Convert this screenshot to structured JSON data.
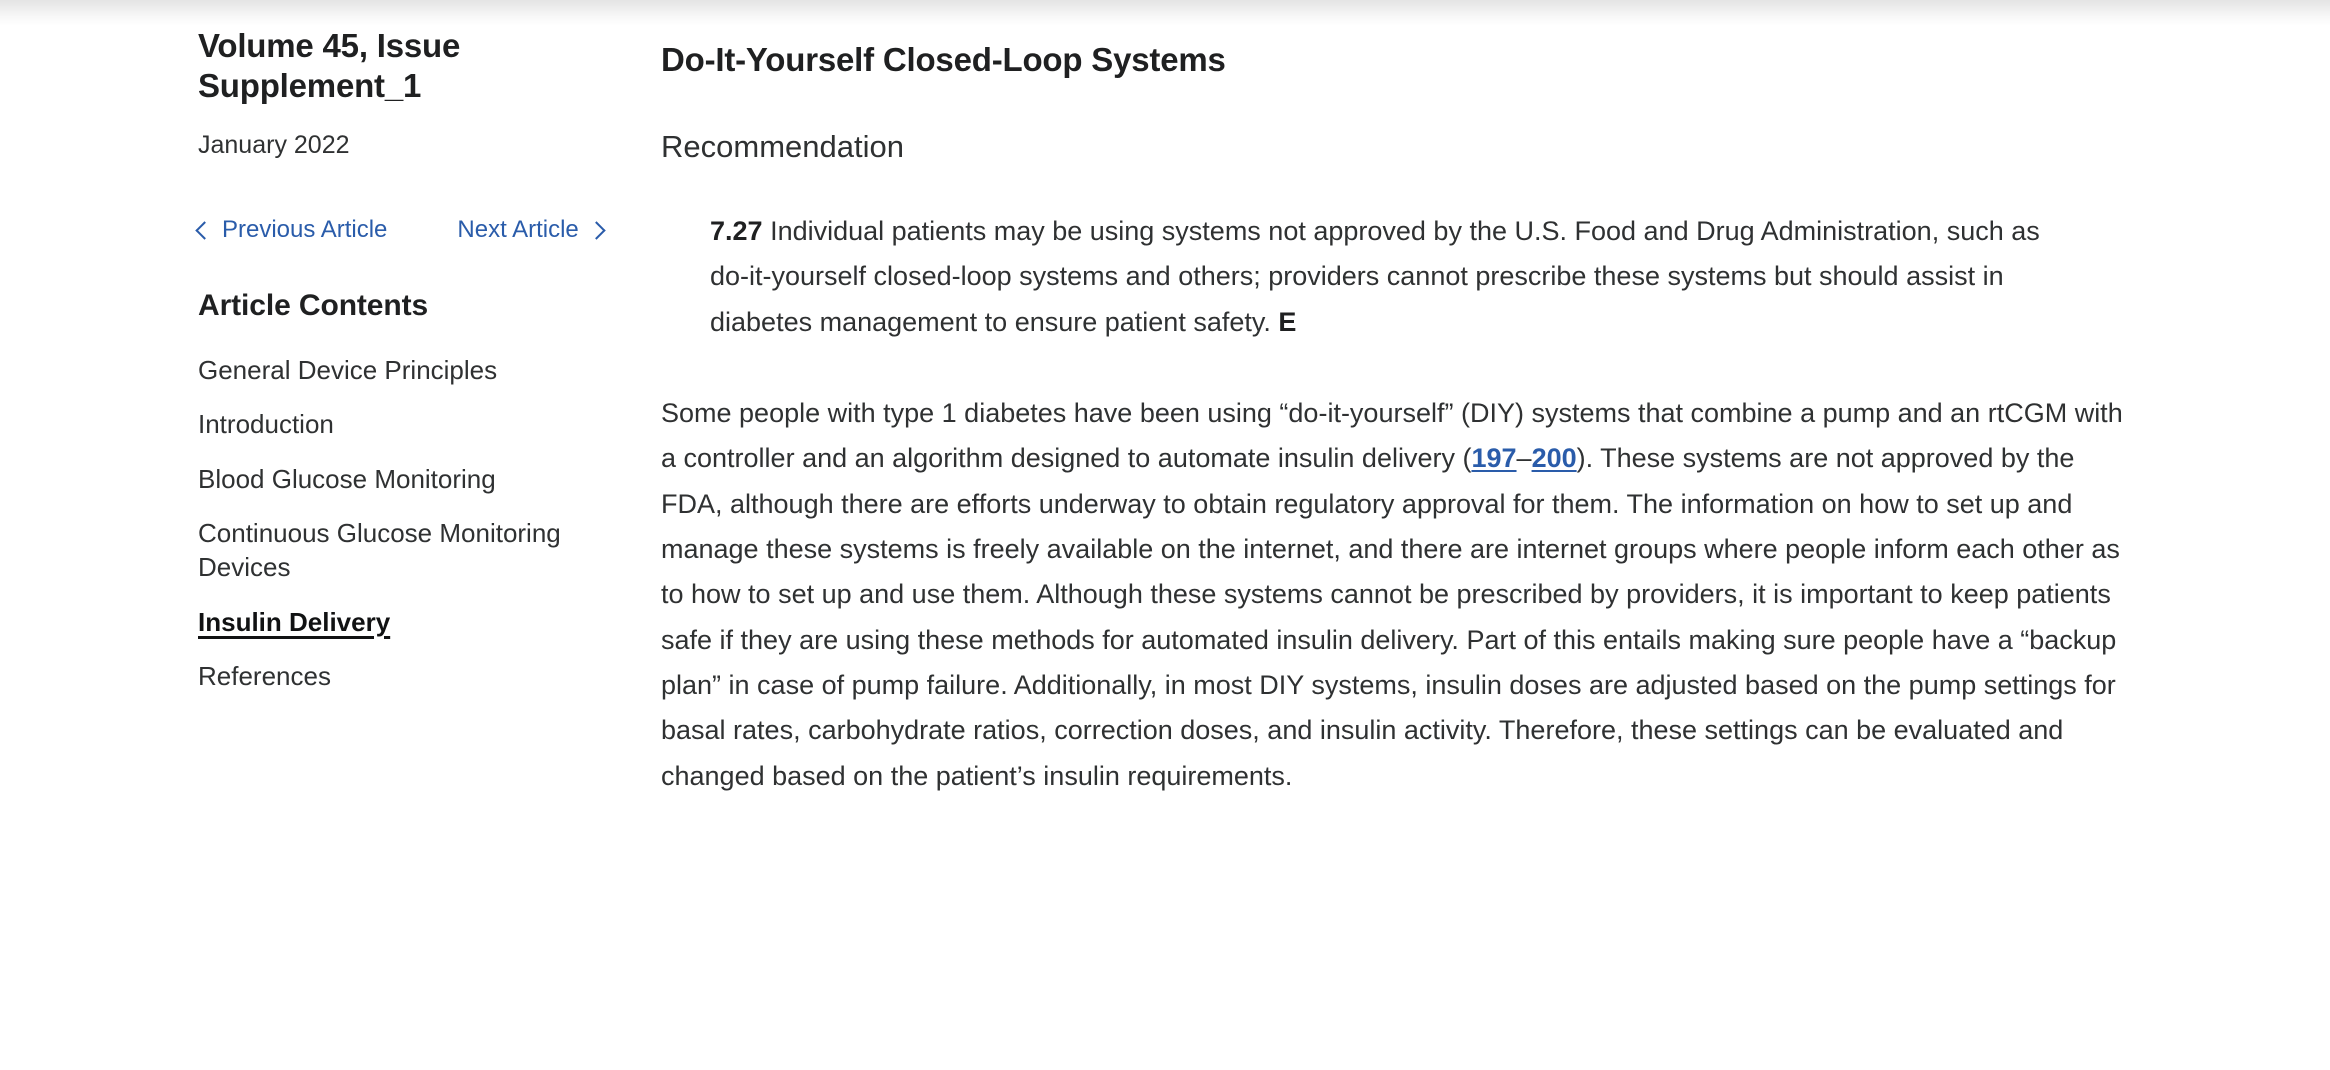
{
  "sidebar": {
    "issue_title": "Volume 45, Issue Supplement_1",
    "issue_date": "January 2022",
    "prev_article_label": "Previous Article",
    "next_article_label": "Next Article",
    "toc_heading": "Article Contents",
    "toc_items": [
      {
        "label": "General Device Principles",
        "active": false
      },
      {
        "label": "Introduction",
        "active": false
      },
      {
        "label": "Blood Glucose Monitoring",
        "active": false
      },
      {
        "label": "Continuous Glucose Monitoring Devices",
        "active": false
      },
      {
        "label": "Insulin Delivery",
        "active": true
      },
      {
        "label": "References",
        "active": false
      }
    ]
  },
  "main": {
    "section_heading": "Do-It-Yourself Closed-Loop Systems",
    "recommendation_heading": "Recommendation",
    "recommendation": {
      "number": "7.27",
      "text": " Individual patients may be using systems not approved by the U.S. Food and Drug Administration, such as do-it-yourself closed-loop systems and others; providers cannot prescribe these systems but should assist in diabetes management to ensure patient safety. ",
      "grade": "E"
    },
    "body": {
      "part1": "Some people with type 1 diabetes have been using “do-it-yourself” (DIY) systems that combine a pump and an rtCGM with a controller and an algorithm designed to automate insulin delivery (",
      "cite_start": "197",
      "cite_dash": "–",
      "cite_end": "200",
      "part2": "). These systems are not approved by the FDA, although there are efforts underway to obtain regulatory approval for them. The information on how to set up and manage these systems is freely available on the internet, and there are internet groups where people inform each other as to how to set up and use them. Although these systems cannot be prescribed by providers, it is important to keep patients safe if they are using these methods for automated insulin delivery. Part of this entails making sure people have a “backup plan” in case of pump failure. Additionally, in most DIY systems, insulin doses are adjusted based on the pump settings for basal rates, carbohydrate ratios, correction doses, and insulin activity. Therefore, these settings can be evaluated and changed based on the patient’s insulin requirements."
    }
  },
  "colors": {
    "link_blue": "#2a5caa",
    "text_primary": "#1f2021",
    "text_body": "#2f3132",
    "background": "#ffffff"
  }
}
